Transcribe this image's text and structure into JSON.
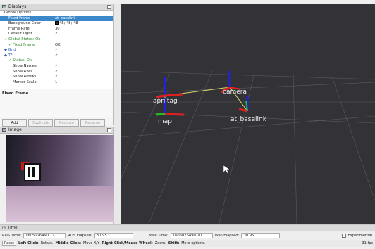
{
  "displays": {
    "title": "Displays",
    "rows": [
      {
        "indent": 1,
        "icon": "gear-icon",
        "key": "Global Options",
        "val": ""
      },
      {
        "indent": 2,
        "key": "Fixed Frame",
        "val": "at_baselink",
        "selected": true
      },
      {
        "indent": 2,
        "key": "Background Color",
        "val": "48; 48; 48",
        "swatch": "#303030"
      },
      {
        "indent": 2,
        "key": "Frame Rate",
        "val": "30"
      },
      {
        "indent": 2,
        "key": "Default Light",
        "val": "✓"
      },
      {
        "indent": 1,
        "key": "Global Status: Ok",
        "val": "",
        "ok": true
      },
      {
        "indent": 2,
        "key": "Fixed Frame",
        "val": "OK",
        "ok": true
      },
      {
        "indent": 1,
        "key": "Grid",
        "val": "✓",
        "blue": true
      },
      {
        "indent": 1,
        "key": "TF",
        "val": "✓",
        "blue": true
      },
      {
        "indent": 2,
        "key": "Status: Ok",
        "val": "",
        "ok": true
      },
      {
        "indent": 3,
        "key": "Show Names",
        "val": "✓"
      },
      {
        "indent": 3,
        "key": "Show Axes",
        "val": "✓"
      },
      {
        "indent": 3,
        "key": "Show Arrows",
        "val": "✓"
      },
      {
        "indent": 3,
        "key": "Marker Scale",
        "val": "1"
      }
    ],
    "description_title": "Fixed Frame",
    "buttons": {
      "add": "Add",
      "duplicate": "Duplicate",
      "remove": "Remove",
      "rename": "Rename"
    }
  },
  "image_panel": {
    "title": "Image"
  },
  "view3d": {
    "frames": [
      {
        "name": "apriltag"
      },
      {
        "name": "camera"
      },
      {
        "name": "map"
      },
      {
        "name": "at_baselink"
      }
    ],
    "colors": {
      "x": "#e02020",
      "y": "#20c020",
      "z": "#2020e0",
      "link": "#d9d96a",
      "bg": "#333337"
    }
  },
  "time": {
    "title": "Time",
    "ros_time_label": "ROS Time:",
    "ros_time": "1605026490.17",
    "ros_elapsed_label": "ROS Elapsed:",
    "ros_elapsed": "30.95",
    "wall_time_label": "Wall Time:",
    "wall_time": "1605026490.20",
    "wall_elapsed_label": "Wall Elapsed:",
    "wall_elapsed": "30.95",
    "experimental": "Experimental"
  },
  "status": {
    "reset": "Reset",
    "left_click": "Left-Click:",
    "left_click_text": "Rotate.",
    "middle_click": "Middle-Click:",
    "middle_click_text": "Move X/Y.",
    "right_click": "Right-Click/Mouse Wheel:",
    "right_click_text": "Zoom.",
    "shift": "Shift:",
    "shift_text": "More options.",
    "fps": "31 fps"
  }
}
